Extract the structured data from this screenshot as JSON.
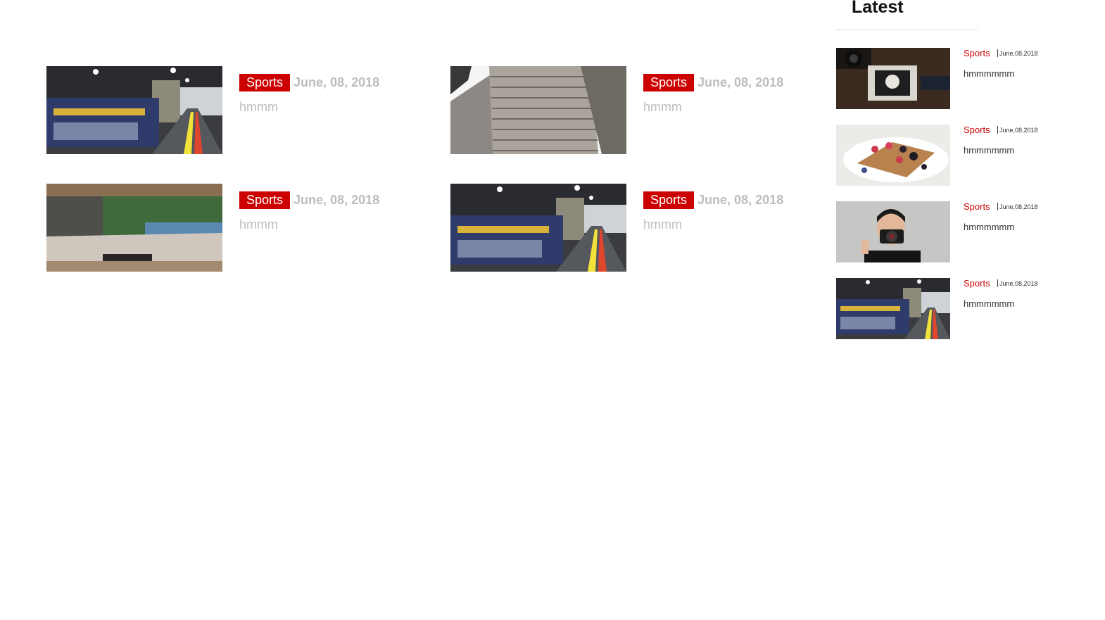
{
  "articles": [
    {
      "category": "Sports",
      "date": "June, 08, 2018",
      "title": "hmmm",
      "image": "factory-floor"
    },
    {
      "category": "Sports",
      "date": "June, 08, 2018",
      "title": "hmmm",
      "image": "office-building"
    },
    {
      "category": "Sports",
      "date": "June, 08, 2018",
      "title": "hmmm",
      "image": "kitchen-window"
    },
    {
      "category": "Sports",
      "date": "June, 08, 2018",
      "title": "hmmm",
      "image": "factory-floor"
    }
  ],
  "sidebar": {
    "heading": "Latest",
    "items": [
      {
        "category": "Sports",
        "date": "June,08,2018",
        "title": "hmmmmmm",
        "image": "camera-photos"
      },
      {
        "category": "Sports",
        "date": "June,08,2018",
        "title": "hmmmmmm",
        "image": "waffle-berries"
      },
      {
        "category": "Sports",
        "date": "June,08,2018",
        "title": "hmmmmmm",
        "image": "photographer"
      },
      {
        "category": "Sports",
        "date": "June,08,2018",
        "title": "hmmmmmm",
        "image": "factory-floor"
      }
    ]
  },
  "colors": {
    "accent": "#cc0000",
    "muted_text": "#bdbdbd",
    "dark_text": "#333333"
  }
}
